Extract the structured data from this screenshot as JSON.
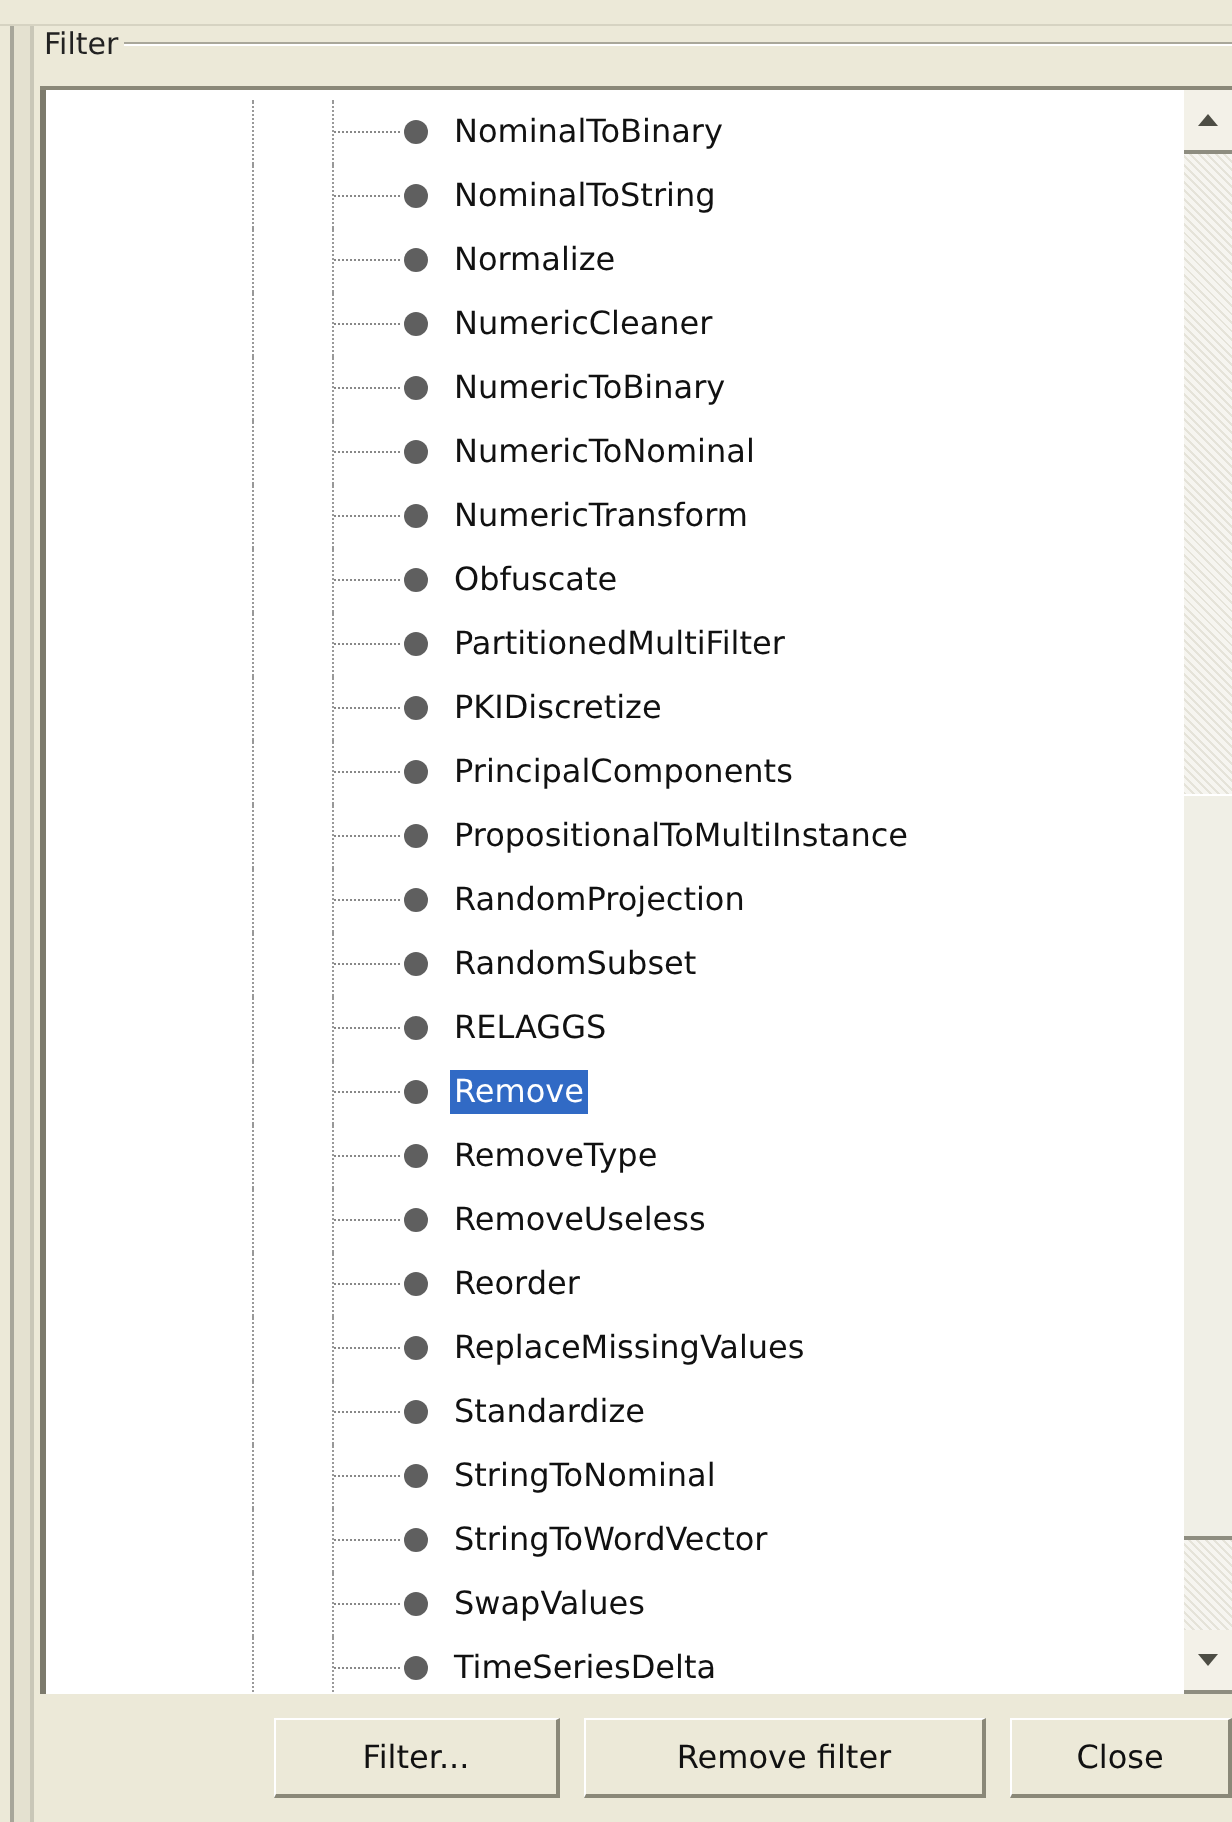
{
  "group": {
    "title": "Filter"
  },
  "tree": {
    "items": [
      {
        "label": "NominalToBinary",
        "selected": false
      },
      {
        "label": "NominalToString",
        "selected": false
      },
      {
        "label": "Normalize",
        "selected": false
      },
      {
        "label": "NumericCleaner",
        "selected": false
      },
      {
        "label": "NumericToBinary",
        "selected": false
      },
      {
        "label": "NumericToNominal",
        "selected": false
      },
      {
        "label": "NumericTransform",
        "selected": false
      },
      {
        "label": "Obfuscate",
        "selected": false
      },
      {
        "label": "PartitionedMultiFilter",
        "selected": false
      },
      {
        "label": "PKIDiscretize",
        "selected": false
      },
      {
        "label": "PrincipalComponents",
        "selected": false
      },
      {
        "label": "PropositionalToMultiInstance",
        "selected": false
      },
      {
        "label": "RandomProjection",
        "selected": false
      },
      {
        "label": "RandomSubset",
        "selected": false
      },
      {
        "label": "RELAGGS",
        "selected": false
      },
      {
        "label": "Remove",
        "selected": true
      },
      {
        "label": "RemoveType",
        "selected": false
      },
      {
        "label": "RemoveUseless",
        "selected": false
      },
      {
        "label": "Reorder",
        "selected": false
      },
      {
        "label": "ReplaceMissingValues",
        "selected": false
      },
      {
        "label": "Standardize",
        "selected": false
      },
      {
        "label": "StringToNominal",
        "selected": false
      },
      {
        "label": "StringToWordVector",
        "selected": false
      },
      {
        "label": "SwapValues",
        "selected": false
      },
      {
        "label": "TimeSeriesDelta",
        "selected": false
      }
    ]
  },
  "buttons": [
    "Filter...",
    "Remove filter",
    "Close"
  ]
}
